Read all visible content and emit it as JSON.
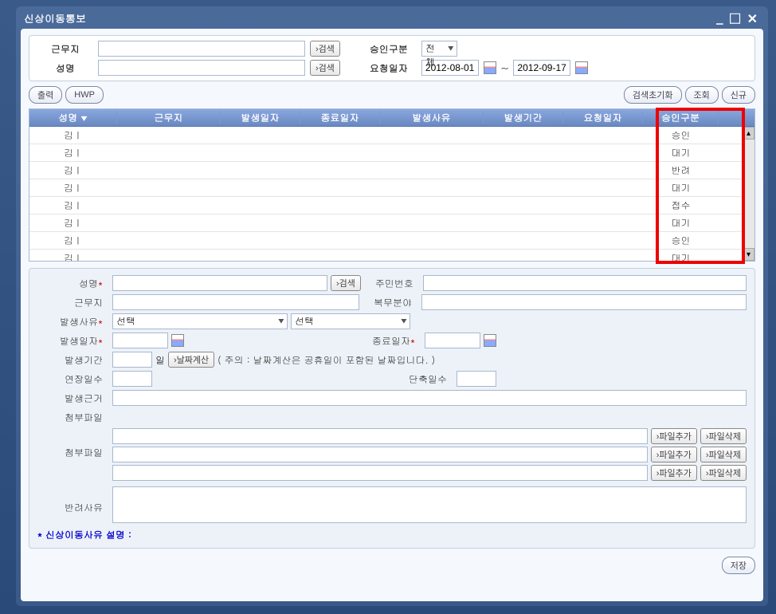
{
  "window": {
    "title": "신상이동통보"
  },
  "search": {
    "workplace_label": "근무지",
    "name_label": "성명",
    "search_btn": "›검색",
    "approval_label": "승인구분",
    "approval_value": "전체",
    "reqdate_label": "요청일자",
    "date_from": "2012-08-01",
    "date_to": "2012-09-17",
    "tilde": "~"
  },
  "toolbar": {
    "print": "출력",
    "hwp": "HWP",
    "reset": "검색초기화",
    "query": "조회",
    "new": "신규"
  },
  "grid": {
    "headers": [
      "성명",
      "근무지",
      "발생일자",
      "종료일자",
      "발생사유",
      "발생기간",
      "요청일자",
      "승인구분"
    ],
    "sort_mark": "▼",
    "rows": [
      {
        "name": "김ㅣ",
        "status": "승인"
      },
      {
        "name": "김ㅣ",
        "status": "대기"
      },
      {
        "name": "김ㅣ",
        "status": "반려"
      },
      {
        "name": "김ㅣ",
        "status": "대기"
      },
      {
        "name": "김ㅣ",
        "status": "접수"
      },
      {
        "name": "김ㅣ",
        "status": "대기"
      },
      {
        "name": "김ㅣ",
        "status": "승인"
      },
      {
        "name": "김ㅣ",
        "status": "대기"
      }
    ]
  },
  "detail": {
    "name_label": "성명",
    "search_btn": "›검색",
    "jumin_label": "주민번호",
    "workplace_label": "근무지",
    "dept_label": "복무분야",
    "reason_label": "발생사유",
    "select_text": "선택",
    "occurdate_label": "발생일자",
    "enddate_label": "종료일자",
    "period_label": "발생기간",
    "day_unit": "일",
    "calc_btn": "›날짜계산",
    "calc_note": "( 주의 : 날짜계산은 공휴일이 포함된 날짜입니다. )",
    "extend_label": "연장일수",
    "shorten_label": "단축일수",
    "basis_label": "발생근거",
    "attach_label": "첨부파일",
    "file_add": "›파일추가",
    "file_del": "›파일삭제",
    "reject_label": "반려사유",
    "explain": "* 신상이동사유 설명 :",
    "save_btn": "저장",
    "req_mark": "*"
  }
}
